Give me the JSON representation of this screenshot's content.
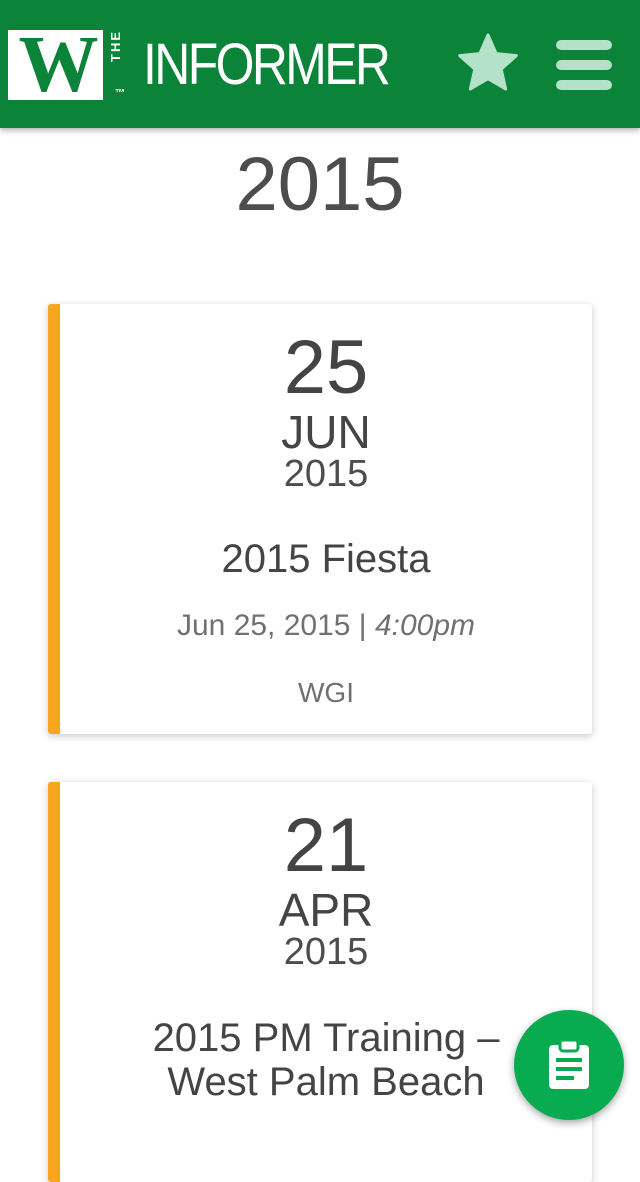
{
  "header": {
    "logo_letter": "W",
    "logo_the": "THE",
    "logo_tm": "™",
    "logo_name": "INFORMER",
    "star_icon": "star-icon",
    "menu_icon": "hamburger-menu-icon",
    "brand_color": "#0b8338",
    "icon_color": "#b3e2c8"
  },
  "year_heading": "2015",
  "events": [
    {
      "day": "25",
      "month": "JUN",
      "year": "2015",
      "title": "2015 Fiesta",
      "date_text": "Jun 25, 2015",
      "separator": " | ",
      "time_text": "4:00pm",
      "org": "WGI"
    },
    {
      "day": "21",
      "month": "APR",
      "year": "2015",
      "title_line1": "2015 PM Training –",
      "title_line2": "West Palm Beach"
    }
  ],
  "accent_color": "#f8a51f",
  "fab": {
    "icon": "clipboard-icon",
    "color": "#08ab4f"
  }
}
